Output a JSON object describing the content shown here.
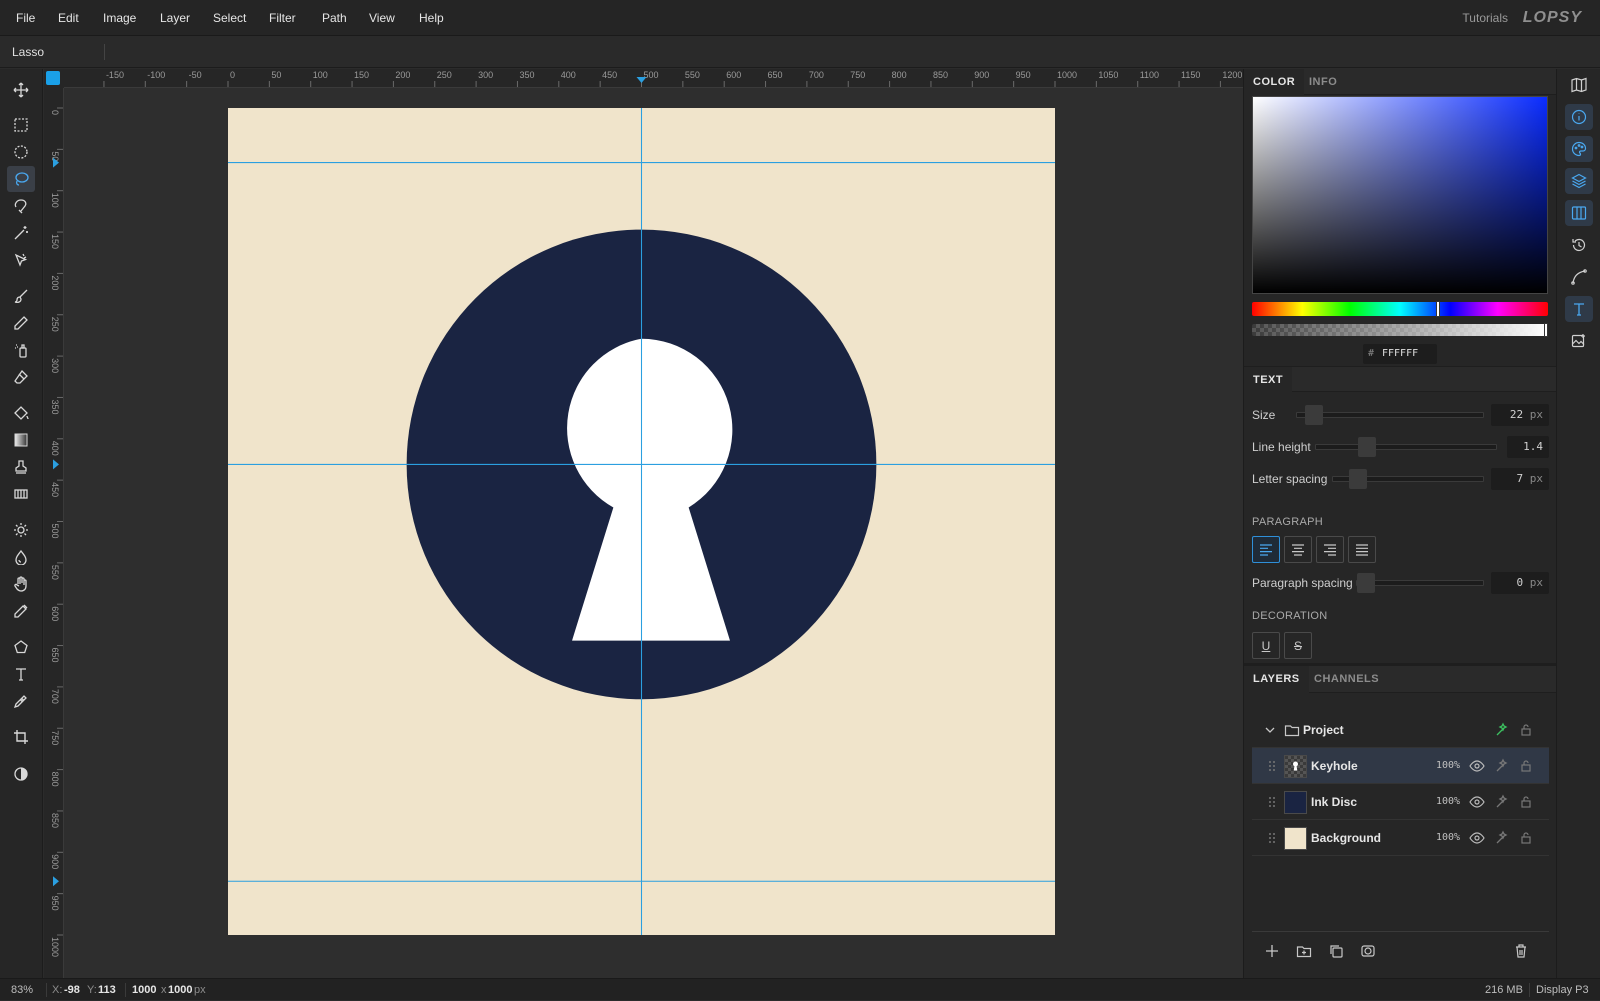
{
  "menu": {
    "items": [
      "File",
      "Edit",
      "Image",
      "Layer",
      "Select",
      "Filter",
      "Path",
      "View",
      "Help"
    ],
    "tutorials": "Tutorials",
    "brand": "LOPSY"
  },
  "options_bar": {
    "tool_name": "Lasso"
  },
  "toolbar": {
    "tools": [
      "move-tool-icon",
      "rect-select-icon",
      "ellipse-select-icon",
      "lasso-icon",
      "magnetic-lasso-icon",
      "magic-wand-icon",
      "quick-select-icon",
      "brush-icon",
      "pencil-icon",
      "spray-icon",
      "eraser-icon",
      "bucket-icon",
      "gradient-icon",
      "stamp-icon",
      "pattern-icon",
      "dodge-icon",
      "burn-icon",
      "hand-icon",
      "eyedropper-icon",
      "polygon-icon",
      "text-icon",
      "pen-icon",
      "crop-icon",
      "contrast-icon"
    ],
    "active_tool": "lasso-icon"
  },
  "rulers": {
    "h_labels": [
      "-150",
      "-100",
      "-50",
      "0",
      "50",
      "100",
      "150",
      "200",
      "250",
      "300",
      "350",
      "400",
      "450",
      "500",
      "550",
      "600",
      "650",
      "700",
      "750",
      "800",
      "850",
      "900",
      "950",
      "1000",
      "1050",
      "1100",
      "1150",
      "1200"
    ],
    "v_labels": [
      "0",
      "50",
      "100",
      "150",
      "200",
      "250",
      "300",
      "350",
      "400",
      "450",
      "500",
      "550",
      "600",
      "650",
      "700",
      "750",
      "800",
      "850",
      "900",
      "950",
      "1000"
    ]
  },
  "document": {
    "background_color": "#f0e4cb",
    "disc_color": "#1a2442",
    "keyhole_color": "#ffffff",
    "guide_color": "#2b9fe0"
  },
  "color_panel": {
    "tabs": [
      "COLOR",
      "INFO"
    ],
    "active_tab": "COLOR",
    "hex_prefix": "#",
    "hex_value": "FFFFFF",
    "hue_color": "#0a2cff"
  },
  "text_panel": {
    "title": "TEXT",
    "size": {
      "label": "Size",
      "value": "22",
      "unit": "px"
    },
    "line_height": {
      "label": "Line height",
      "value": "1.4"
    },
    "letter_spacing": {
      "label": "Letter spacing",
      "value": "7",
      "unit": "px"
    },
    "paragraph_label": "PARAGRAPH",
    "paragraph_spacing": {
      "label": "Paragraph spacing",
      "value": "0",
      "unit": "px"
    },
    "decoration_label": "DECORATION",
    "underline": "U",
    "strike": "S"
  },
  "layers_panel": {
    "tabs": [
      "LAYERS",
      "CHANNELS"
    ],
    "active_tab": "LAYERS",
    "group_name": "Project",
    "layers": [
      {
        "name": "Keyhole",
        "opacity": "100%"
      },
      {
        "name": "Ink Disc",
        "opacity": "100%"
      },
      {
        "name": "Background",
        "opacity": "100%"
      }
    ],
    "active_layer": "Keyhole"
  },
  "status": {
    "zoom": "83%",
    "x_label": "X:",
    "x_value": "-98",
    "y_label": "Y:",
    "y_value": "113",
    "doc_w": "1000",
    "doc_x": "x",
    "doc_h": "1000",
    "doc_unit": "px",
    "memory": "216 MB",
    "display": "Display P3"
  }
}
